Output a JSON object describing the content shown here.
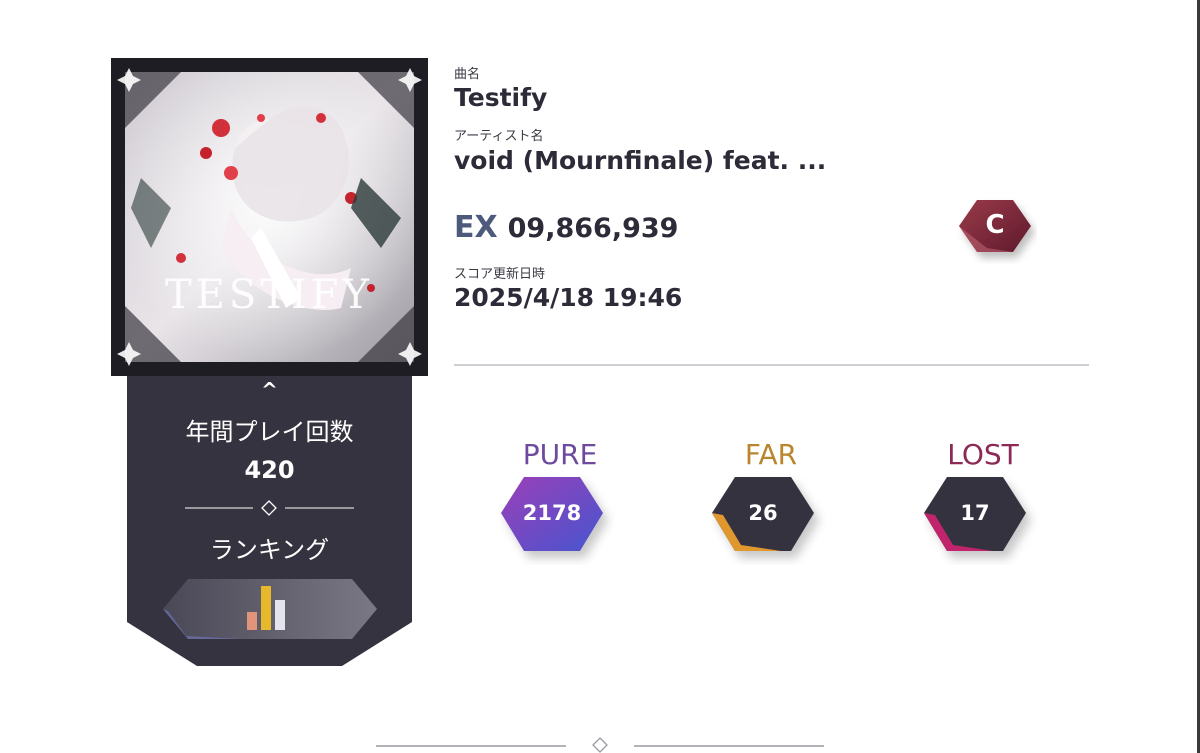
{
  "song": {
    "title_label": "曲名",
    "title": "Testify",
    "artist_label": "アーティスト名",
    "artist": "void (Mournfinale) feat. ..."
  },
  "score": {
    "difficulty": "EX",
    "value": "09,866,939",
    "grade": "C",
    "updated_label": "スコア更新日時",
    "updated": "2025/4/18 19:46"
  },
  "panel": {
    "caret": "^",
    "plays_label": "年間プレイ回数",
    "plays_value": "420",
    "ranking_label": "ランキング"
  },
  "judgements": {
    "pure": {
      "label": "PURE",
      "value": "2178",
      "color": "#6e4a9e"
    },
    "far": {
      "label": "FAR",
      "value": "26",
      "color": "#b8862c"
    },
    "lost": {
      "label": "LOST",
      "value": "17",
      "color": "#8c2a55"
    }
  },
  "jacket": {
    "art_text": "TESTIFY"
  },
  "colors": {
    "panel": "#35333f",
    "grade_badge": "#7a2435",
    "pure_gradient": [
      "#8a3fb8",
      "#4a5ad0"
    ],
    "far_accent": "#e0972e",
    "lost_accent": "#c0246c",
    "rank_bar_gold": "#e8b82c",
    "rank_bar_copper": "#e0957a",
    "rank_bar_silver": "#e4e4ee"
  },
  "icons": {
    "ranking": "bar-chart-icon",
    "divider": "diamond-icon",
    "caret": "chevron-up-icon"
  }
}
